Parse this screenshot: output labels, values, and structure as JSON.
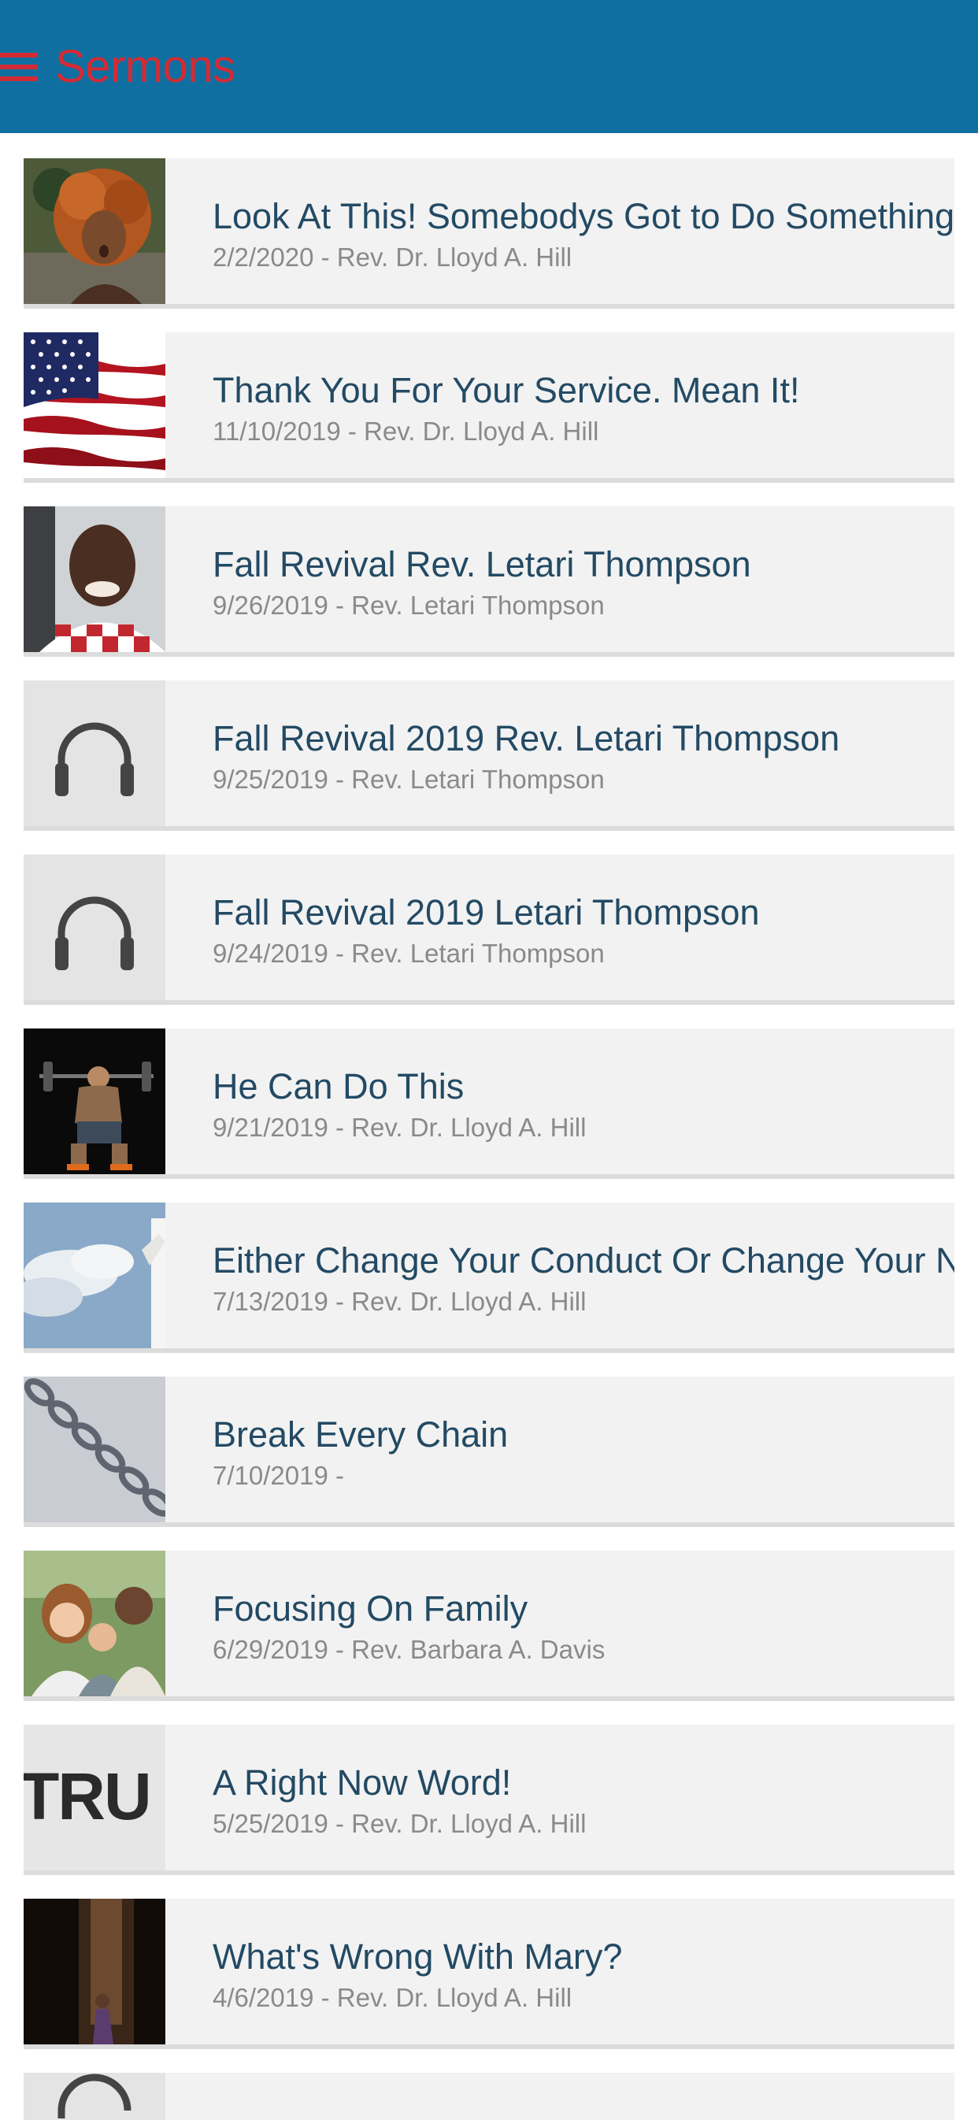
{
  "header": {
    "title": "Sermons",
    "menu_icon": "hamburger-icon",
    "title_color": "#d32b35",
    "bar_color": "#106fa1"
  },
  "sermons": [
    {
      "title": "Look At This! Somebodys Got to Do Something.",
      "meta": "2/2/2020 - Rev. Dr. Lloyd A. Hill",
      "thumbnail": "woman-curly-hair-photo"
    },
    {
      "title": "Thank You For Your Service. Mean It!",
      "meta": "11/10/2019 - Rev. Dr. Lloyd A. Hill",
      "thumbnail": "american-flag-photo"
    },
    {
      "title": "Fall Revival Rev. Letari Thompson",
      "meta": "9/26/2019 - Rev. Letari Thompson",
      "thumbnail": "man-selfie-photo"
    },
    {
      "title": "Fall Revival 2019 Rev. Letari Thompson",
      "meta": "9/25/2019 - Rev. Letari Thompson",
      "thumbnail": "headphones-icon"
    },
    {
      "title": "Fall Revival 2019 Letari Thompson",
      "meta": "9/24/2019 - Rev. Letari Thompson",
      "thumbnail": "headphones-icon"
    },
    {
      "title": "He Can Do This",
      "meta": "9/21/2019 - Rev. Dr. Lloyd A. Hill",
      "thumbnail": "weightlifter-photo"
    },
    {
      "title": "Either Change Your Conduct Or Change Your Na",
      "meta": "7/13/2019 - Rev. Dr. Lloyd A. Hill",
      "thumbnail": "sky-clouds-photo"
    },
    {
      "title": "Break Every Chain",
      "meta": "7/10/2019 -",
      "thumbnail": "chain-photo"
    },
    {
      "title": "Focusing On Family",
      "meta": "6/29/2019 - Rev. Barbara A. Davis",
      "thumbnail": "family-photo"
    },
    {
      "title": "A Right Now Word!",
      "meta": "5/25/2019 - Rev. Dr. Lloyd A. Hill",
      "thumbnail": "tru-text-graphic"
    },
    {
      "title": "What's Wrong With Mary?",
      "meta": "4/6/2019 - Rev. Dr. Lloyd A. Hill",
      "thumbnail": "dark-room-woman-photo"
    }
  ],
  "tru_graphic_text": "TRU"
}
